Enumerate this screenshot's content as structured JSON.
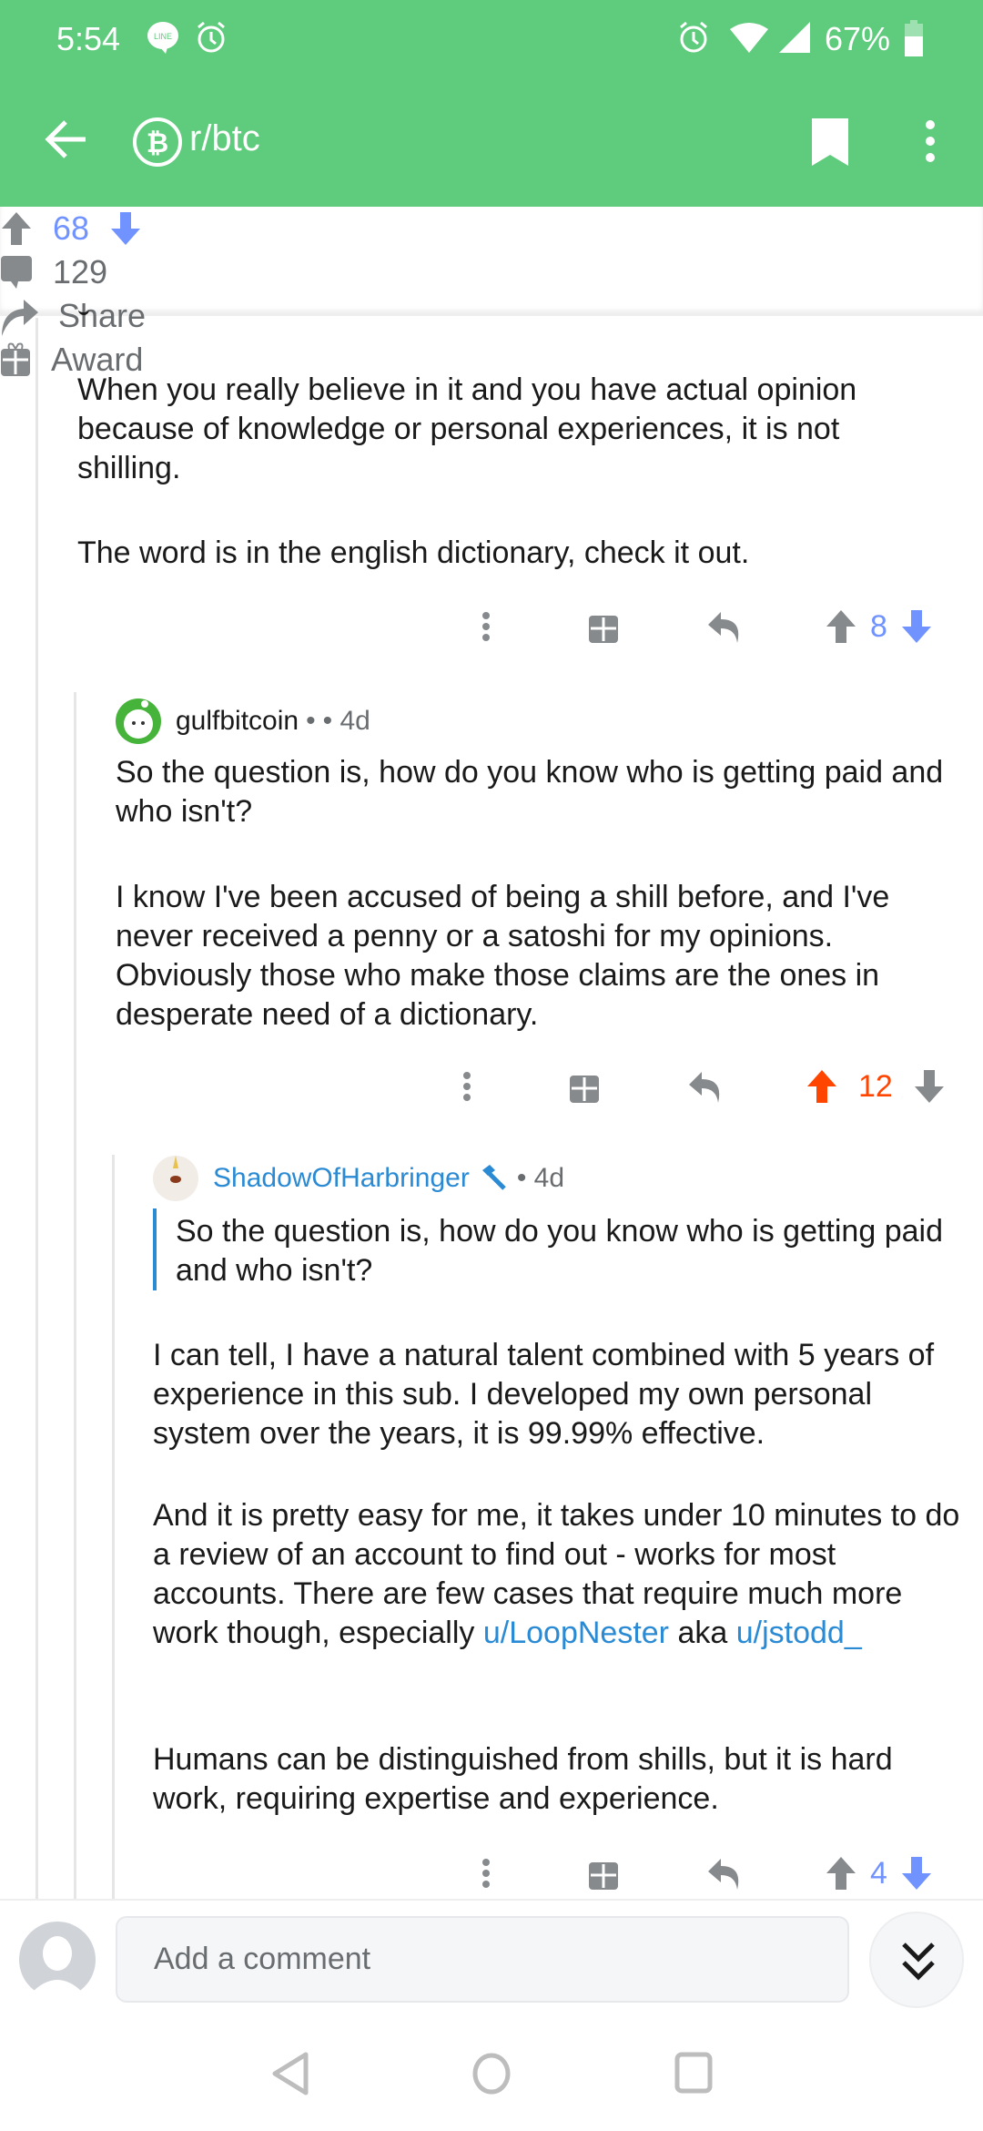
{
  "status_bar": {
    "time": "5:54",
    "battery": "67%",
    "notification_icons": [
      "line-icon",
      "alarm-icon"
    ],
    "right_icons": [
      "alarm-icon",
      "wifi-icon",
      "signal-icon",
      "battery-icon"
    ]
  },
  "header": {
    "subreddit": "r/btc",
    "icons": [
      "back-arrow-icon",
      "bitcoin-icon",
      "bookmark-icon",
      "more-vert-icon"
    ]
  },
  "post_actions": {
    "score": "68",
    "comments": "129",
    "share": "Share",
    "award": "Award",
    "vote_state": "downvoted",
    "vote_color": "#7193ff"
  },
  "comments": [
    {
      "partial_top": true,
      "paragraphs": [
        "When you really believe in it and you have actual opinion because of knowledge or personal experiences, it is not shilling.",
        "The word is in the english dictionary, check it out."
      ],
      "score": "8",
      "vote_state": "downvoted"
    },
    {
      "author": "gulfbitcoin",
      "sep": "•",
      "age": "• 4d",
      "paragraphs": [
        "So the question is, how do you know who is getting paid and who isn't?",
        "I know I've been accused of being a shill before, and I've never received a penny or a satoshi for my opinions. Obviously those who make those claims are the ones in desperate need of a dictionary."
      ],
      "score": "12",
      "vote_state": "upvoted",
      "vote_color": "#ff4500"
    },
    {
      "author": "ShadowOfHarbringer",
      "author_color": "#2a8ad4",
      "age": "• 4d",
      "quote": "So the question is, how do you know who is getting paid and who isn't?",
      "p1": "I can tell, I have a natural talent combined with 5 years of experience in this sub. I developed my own personal system over the years, it is 99.99% effective.",
      "p2_text": "And it is pretty easy for me, it takes under 10 minutes to do a review of an account to find out - works for most accounts. There are few cases that require much more work though, especially ",
      "p2_link1": "u/LoopNester",
      "p2_mid": " aka ",
      "p2_link2": "u/jstodd_",
      "p3": "Humans can be distinguished from shills, but it is hard work, requiring expertise and experience.",
      "score": "4",
      "vote_state": "downvoted"
    }
  ],
  "composer": {
    "placeholder": "Add a comment"
  },
  "nav": [
    "back-icon",
    "home-icon",
    "recents-icon"
  ]
}
